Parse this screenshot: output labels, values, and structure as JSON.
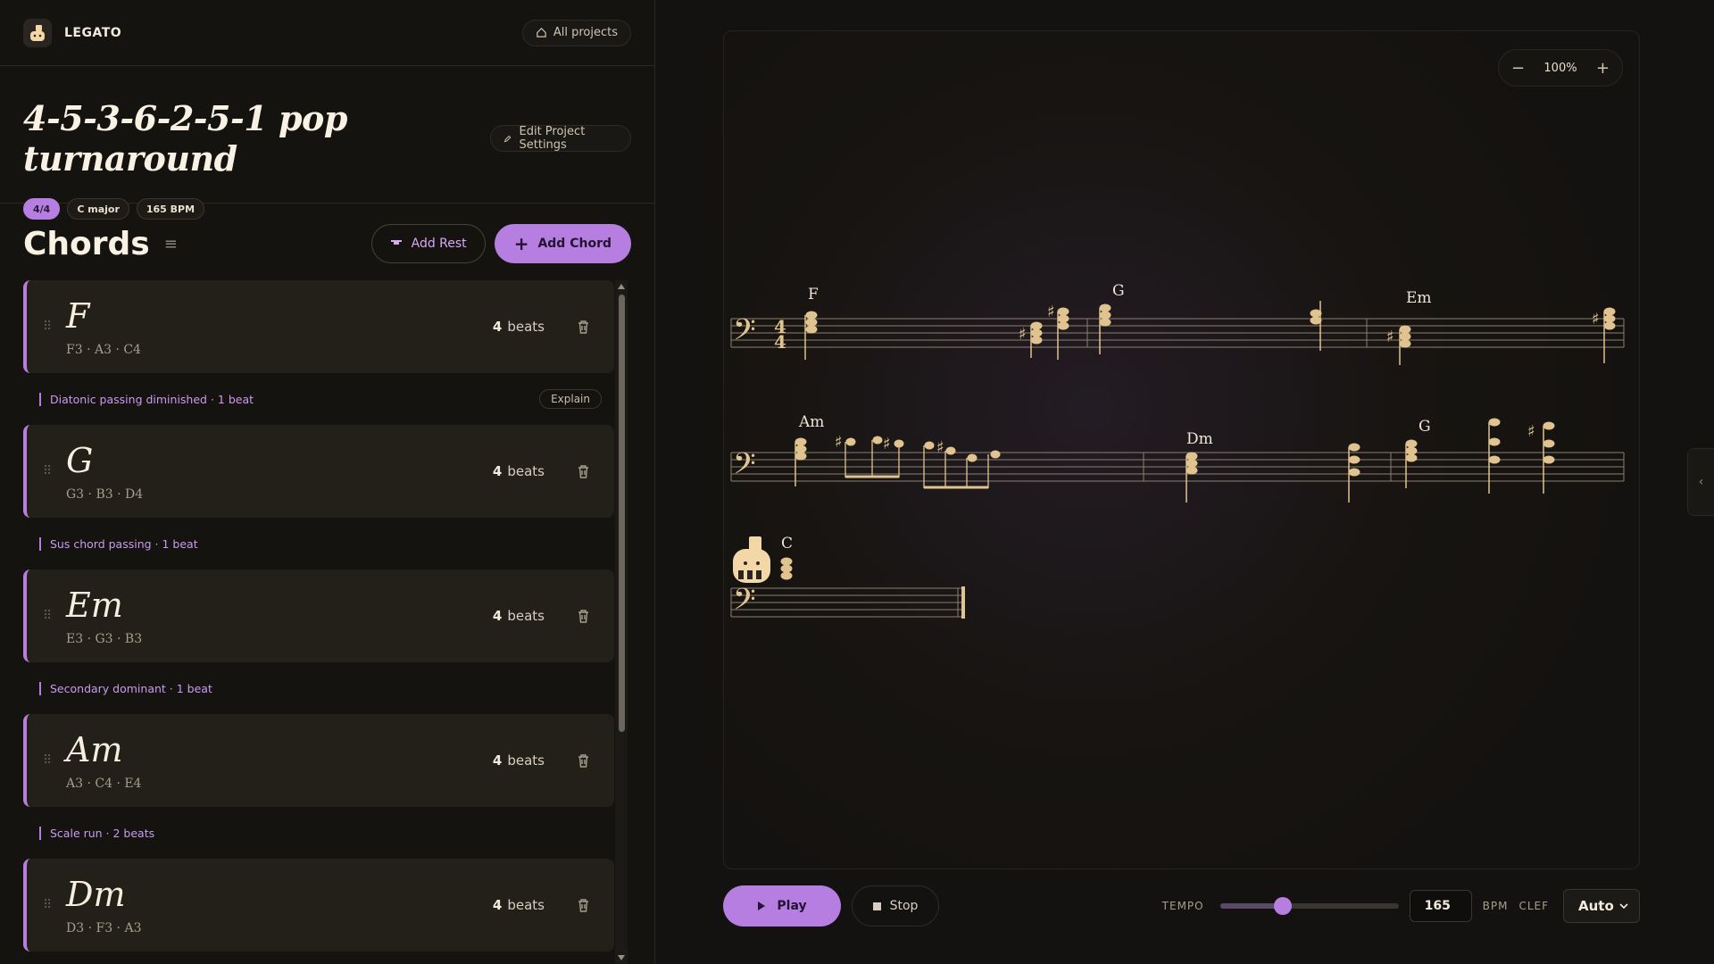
{
  "app": {
    "brand": "LEGATO",
    "all_projects_label": "All projects"
  },
  "project": {
    "title": "4-5-3-6-2-5-1 pop turnaround",
    "edit_label": "Edit Project Settings",
    "tags": [
      "4/4",
      "C major",
      "165 BPM"
    ]
  },
  "chords_section": {
    "title": "Chords",
    "add_rest_label": "Add Rest",
    "add_chord_label": "Add Chord"
  },
  "chords": [
    {
      "name": "F",
      "notes": "F3 · A3 · C4",
      "beats": "4",
      "beats_unit": "beats"
    },
    {
      "name": "G",
      "notes": "G3 · B3 · D4",
      "beats": "4",
      "beats_unit": "beats"
    },
    {
      "name": "Em",
      "notes": "E3 · G3 · B3",
      "beats": "4",
      "beats_unit": "beats"
    },
    {
      "name": "Am",
      "notes": "A3 · C4 · E4",
      "beats": "4",
      "beats_unit": "beats"
    },
    {
      "name": "Dm",
      "notes": "D3 · F3 · A3",
      "beats": "4",
      "beats_unit": "beats"
    }
  ],
  "passings": [
    {
      "text": "Diatonic passing diminished · 1 beat",
      "explain_label": "Explain"
    },
    {
      "text": "Sus chord passing · 1 beat"
    },
    {
      "text": "Secondary dominant · 1 beat"
    },
    {
      "text": "Scale run · 2 beats"
    }
  ],
  "score": {
    "zoom": "100%",
    "time_signature_top": "4",
    "time_signature_bottom": "4",
    "chord_symbols": [
      "F",
      "G",
      "Em",
      "Am",
      "Dm",
      "G",
      "C"
    ]
  },
  "transport": {
    "play_label": "Play",
    "stop_label": "Stop",
    "tempo_label": "TEMPO",
    "tempo_value": "165",
    "tempo_fraction": 0.35,
    "bpm_label": "BPM",
    "clef_label": "CLEF",
    "clef_value": "Auto"
  },
  "colors": {
    "accent": "#b57ee0",
    "note": "#e0c38f",
    "background": "#141210"
  }
}
